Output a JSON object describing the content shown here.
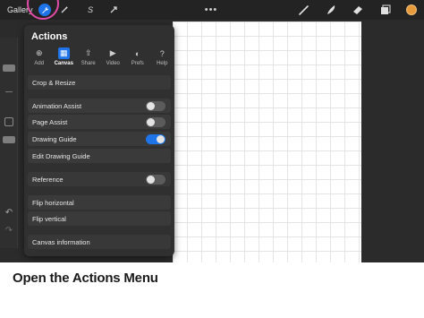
{
  "toolbar": {
    "gallery_label": "Gallery",
    "more_label": "•••",
    "accent_color": "#1e74e8",
    "current_color": "#e79a3a",
    "icons": [
      "wrench-icon",
      "magic-wand-icon",
      "selection-icon",
      "transform-icon",
      "brush-icon",
      "smudge-icon",
      "eraser-icon",
      "layers-icon",
      "color-swatch-icon"
    ]
  },
  "sidebar": {
    "undo_icon": "↶",
    "redo_icon": "↷"
  },
  "panel": {
    "title": "Actions",
    "tabs": [
      {
        "label": "Add",
        "icon": "⊕",
        "active": false
      },
      {
        "label": "Canvas",
        "icon": "▦",
        "active": true
      },
      {
        "label": "Share",
        "icon": "⇧",
        "active": false
      },
      {
        "label": "Video",
        "icon": "▶",
        "active": false
      },
      {
        "label": "Prefs",
        "icon": "◐",
        "active": false
      },
      {
        "label": "Help",
        "icon": "?",
        "active": false
      }
    ],
    "items": {
      "crop_resize": "Crop & Resize",
      "animation_assist": "Animation Assist",
      "page_assist": "Page Assist",
      "drawing_guide": "Drawing Guide",
      "edit_drawing_guide": "Edit Drawing Guide",
      "reference": "Reference",
      "flip_horizontal": "Flip horizontal",
      "flip_vertical": "Flip vertical",
      "canvas_information": "Canvas information"
    },
    "toggles": {
      "animation_assist": false,
      "page_assist": false,
      "drawing_guide": true,
      "reference": false
    }
  },
  "caption": "Open the Actions Menu",
  "highlight_color": "#e24ba7"
}
